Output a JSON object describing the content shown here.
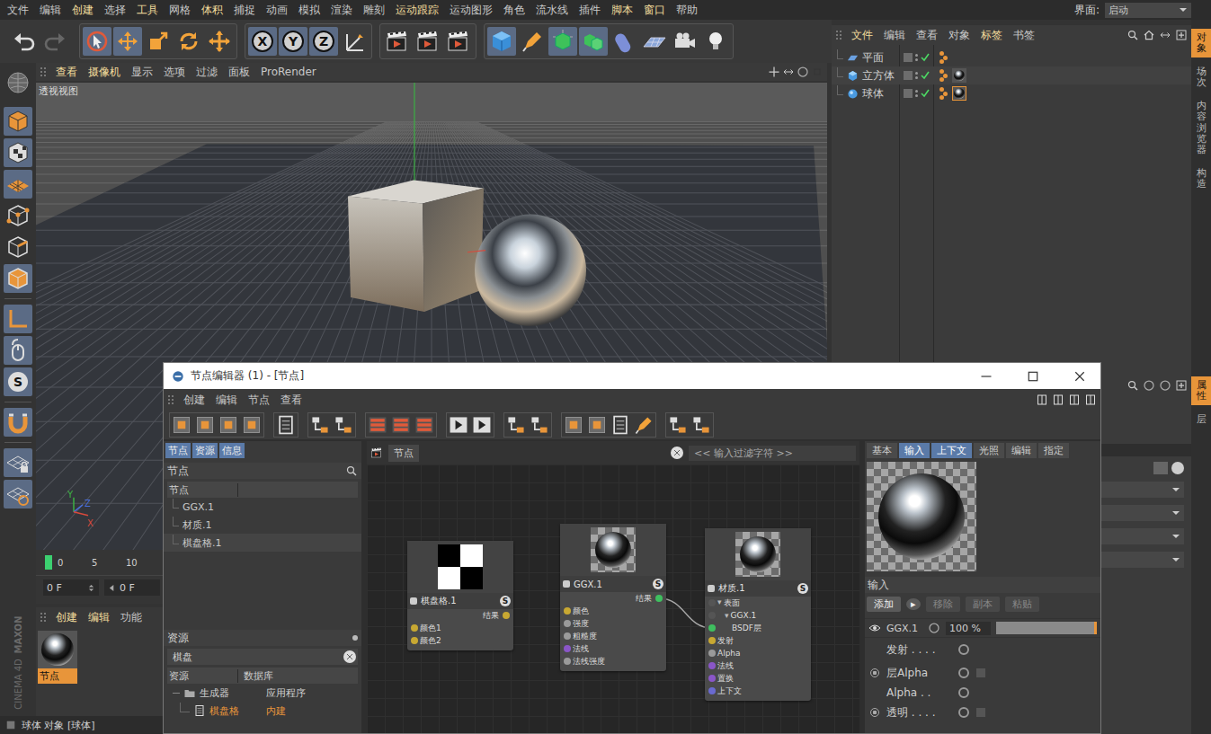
{
  "menubar": {
    "items": [
      {
        "label": "文件",
        "highlight": false
      },
      {
        "label": "编辑",
        "highlight": false
      },
      {
        "label": "创建",
        "highlight": true
      },
      {
        "label": "选择",
        "highlight": false
      },
      {
        "label": "工具",
        "highlight": true
      },
      {
        "label": "网格",
        "highlight": false
      },
      {
        "label": "体积",
        "highlight": true
      },
      {
        "label": "捕捉",
        "highlight": false
      },
      {
        "label": "动画",
        "highlight": false
      },
      {
        "label": "模拟",
        "highlight": false
      },
      {
        "label": "渲染",
        "highlight": false
      },
      {
        "label": "雕刻",
        "highlight": false
      },
      {
        "label": "运动跟踪",
        "highlight": true
      },
      {
        "label": "运动图形",
        "highlight": false
      },
      {
        "label": "角色",
        "highlight": false
      },
      {
        "label": "流水线",
        "highlight": false
      },
      {
        "label": "插件",
        "highlight": false
      },
      {
        "label": "脚本",
        "highlight": true
      },
      {
        "label": "窗口",
        "highlight": true
      },
      {
        "label": "帮助",
        "highlight": false
      }
    ],
    "layout_label": "界面:",
    "layout_value": "启动"
  },
  "toolbar": {
    "axis_buttons": [
      {
        "label": "X",
        "selected": true
      },
      {
        "label": "Y",
        "selected": true
      },
      {
        "label": "Z",
        "selected": true
      }
    ]
  },
  "left_toolbar": {
    "badge": "S"
  },
  "viewport": {
    "menu": [
      {
        "label": "查看",
        "highlight": true
      },
      {
        "label": "摄像机",
        "highlight": true
      },
      {
        "label": "显示",
        "highlight": false
      },
      {
        "label": "选项",
        "highlight": false
      },
      {
        "label": "过滤",
        "highlight": false
      },
      {
        "label": "面板",
        "highlight": false
      },
      {
        "label": "ProRender",
        "highlight": false
      }
    ],
    "title": "透视视图",
    "axes": [
      {
        "label": "Y",
        "color": "#3cb043"
      },
      {
        "label": "Z",
        "color": "#4a6fd8"
      },
      {
        "label": "X",
        "color": "#d84a3c"
      }
    ]
  },
  "object_manager": {
    "menu": [
      {
        "label": "文件",
        "highlight": true
      },
      {
        "label": "编辑",
        "highlight": false
      },
      {
        "label": "查看",
        "highlight": false
      },
      {
        "label": "对象",
        "highlight": false
      },
      {
        "label": "标签",
        "highlight": true
      },
      {
        "label": "书签",
        "highlight": false
      }
    ],
    "objects": [
      {
        "name": "平面",
        "kind": "plane",
        "enabled": true,
        "material": false,
        "tag_selected": false
      },
      {
        "name": "立方体",
        "kind": "cube",
        "enabled": true,
        "material": true,
        "tag_selected": false
      },
      {
        "name": "球体",
        "kind": "sphere",
        "enabled": true,
        "material": true,
        "tag_selected": true
      }
    ]
  },
  "side_tabs": {
    "top": [
      {
        "label": "对象",
        "selected": true
      },
      {
        "label": "场次",
        "selected": false
      },
      {
        "label": "内容浏览器",
        "selected": false
      },
      {
        "label": "构造",
        "selected": false
      }
    ],
    "bottom": [
      {
        "label": "属性",
        "selected": true
      },
      {
        "label": "层",
        "selected": false
      }
    ]
  },
  "timeline": {
    "ticks": [
      "0",
      "5",
      "10"
    ],
    "frame_fields": [
      "0 F",
      "0 F"
    ]
  },
  "material_manager": {
    "menu": [
      {
        "label": "创建",
        "highlight": true
      },
      {
        "label": "编辑",
        "highlight": true
      },
      {
        "label": "功能",
        "highlight": false
      }
    ],
    "materials": [
      {
        "name": "节点",
        "selected": true
      }
    ]
  },
  "logo": {
    "lines": [
      "MAXON",
      "CINEMA 4D"
    ]
  },
  "status_bar": {
    "text": "球体 对象 [球体]"
  },
  "node_editor": {
    "title": "节点编辑器 (1) - [节点]",
    "menu": [
      "创建",
      "编辑",
      "节点",
      "查看"
    ],
    "left_tabs": [
      {
        "label": "节点",
        "selected": true
      },
      {
        "label": "资源",
        "selected": true
      },
      {
        "label": "信息",
        "selected": true
      }
    ],
    "nodes_panel": {
      "title": "节点",
      "column": "节点",
      "items": [
        {
          "name": "GGX.1",
          "selected": false
        },
        {
          "name": "材质.1",
          "selected": false
        },
        {
          "name": "棋盘格.1",
          "selected": true
        }
      ]
    },
    "assets_panel": {
      "title": "资源",
      "search": "棋盘",
      "columns": [
        "资源",
        "数据库"
      ],
      "rows": [
        {
          "name": "生成器",
          "database": "应用程序",
          "kind": "folder",
          "selected": false
        },
        {
          "name": "棋盘格",
          "database": "内建",
          "kind": "item",
          "selected": true
        }
      ]
    },
    "canvas": {
      "tab": "节点",
      "filter_placeholder": "<< 输入过滤字符 >>"
    },
    "graph_nodes": [
      {
        "title": "棋盘格.1",
        "preview": "checker",
        "badge": "S",
        "outputs": [
          {
            "label": "结果",
            "color": "#c8a832"
          }
        ],
        "inputs": [
          {
            "label": "颜色1",
            "color": "#c8a832",
            "indent": 0
          },
          {
            "label": "颜色2",
            "color": "#c8a832",
            "indent": 0
          }
        ]
      },
      {
        "title": "GGX.1",
        "preview": "sphere",
        "badge": "S",
        "outputs": [
          {
            "label": "结果",
            "color": "#3fbf5f"
          }
        ],
        "inputs": [
          {
            "label": "颜色",
            "color": "#c8a832",
            "indent": 0
          },
          {
            "label": "强度",
            "color": "#9a9a9a",
            "indent": 0
          },
          {
            "label": "粗糙度",
            "color": "#9a9a9a",
            "indent": 0
          },
          {
            "label": "法线",
            "color": "#8a56c8",
            "indent": 0
          },
          {
            "label": "法线强度",
            "color": "#9a9a9a",
            "indent": 0
          }
        ]
      },
      {
        "title": "材质.1",
        "preview": "sphere",
        "badge": "S",
        "outputs": [],
        "inputs": [
          {
            "label": "表面",
            "color": "#555555",
            "indent": 0,
            "toggle": "▾"
          },
          {
            "label": "GGX.1",
            "color": "#555555",
            "indent": 1,
            "toggle": "▾"
          },
          {
            "label": "BSDF层",
            "color": "#3fbf5f",
            "indent": 2
          },
          {
            "label": "发射",
            "color": "#c8a832",
            "indent": 0
          },
          {
            "label": "Alpha",
            "color": "#9a9a9a",
            "indent": 0
          },
          {
            "label": "法线",
            "color": "#8a56c8",
            "indent": 0
          },
          {
            "label": "置换",
            "color": "#8a56c8",
            "indent": 0
          },
          {
            "label": "上下文",
            "color": "#6a6ad0",
            "indent": 0
          }
        ]
      }
    ],
    "connections": [
      {
        "from": "GGX.1",
        "from_port": "结果",
        "to": "材质.1",
        "to_port": "BSDF层"
      }
    ],
    "attributes": {
      "tabs": [
        {
          "label": "基本",
          "selected": false
        },
        {
          "label": "输入",
          "selected": true
        },
        {
          "label": "上下文",
          "selected": true
        },
        {
          "label": "光照",
          "selected": false
        },
        {
          "label": "编辑",
          "selected": false
        },
        {
          "label": "指定",
          "selected": false
        }
      ],
      "section": "输入",
      "buttons": [
        {
          "label": "添加",
          "disabled": false
        },
        {
          "label": "▸",
          "disabled": false
        },
        {
          "label": "移除",
          "disabled": true
        },
        {
          "label": "副本",
          "disabled": true
        },
        {
          "label": "粘贴",
          "disabled": true
        }
      ],
      "layer": {
        "name": "GGX.1",
        "value": "100 %",
        "level": 1
      },
      "params": [
        {
          "label": "发射 . . . .",
          "kind": "link",
          "radio": false
        },
        {
          "label": "层Alpha",
          "kind": "link_check",
          "radio": true
        },
        {
          "label": "Alpha . .",
          "kind": "link",
          "radio": false
        },
        {
          "label": "透明 . . . .",
          "kind": "link_check",
          "radio": true
        }
      ]
    }
  }
}
